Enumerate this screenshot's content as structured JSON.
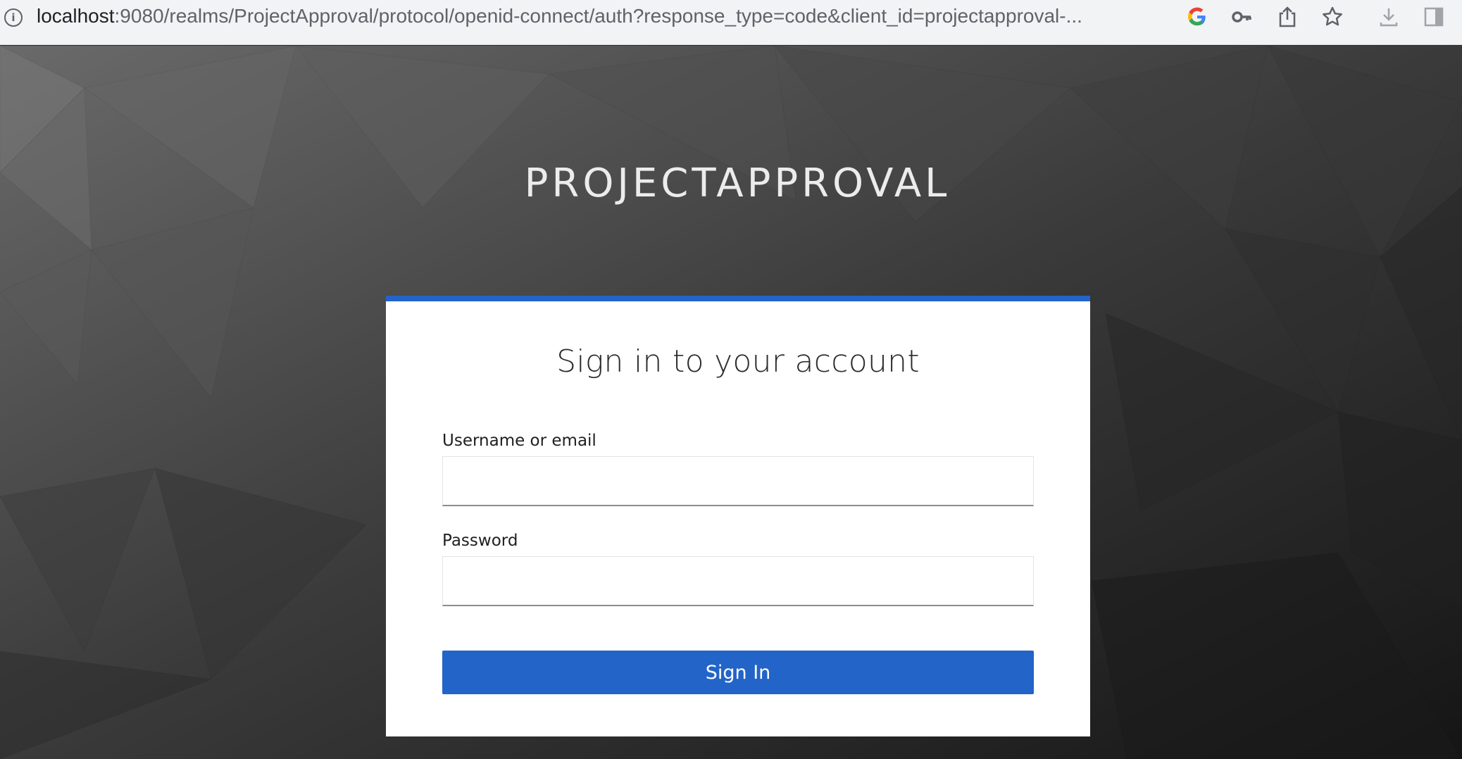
{
  "browser": {
    "url_host": "localhost",
    "url_rest": ":9080/realms/ProjectApproval/protocol/openid-connect/auth?response_type=code&client_id=projectapproval-...",
    "icons": [
      "info-icon",
      "google-icon",
      "key-icon",
      "share-icon",
      "star-icon",
      "download-icon",
      "sidebar-icon"
    ]
  },
  "realm": {
    "name": "PROJECTAPPROVAL"
  },
  "login": {
    "title": "Sign in to your account",
    "username_label": "Username or email",
    "username_value": "",
    "password_label": "Password",
    "password_value": "",
    "submit_label": "Sign In"
  },
  "colors": {
    "accent": "#2264c8",
    "card_background": "#ffffff"
  }
}
